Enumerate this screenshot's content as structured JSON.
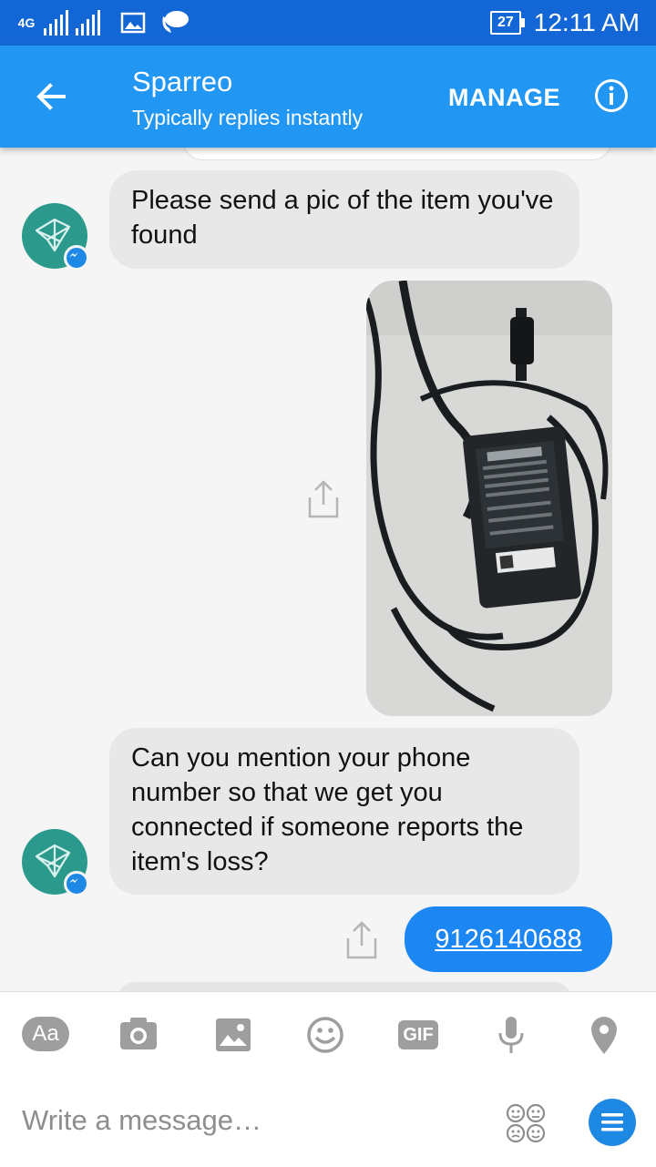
{
  "status_bar": {
    "network": "4G",
    "battery_level": "27",
    "time": "12:11 AM",
    "icons": [
      "signal-icon",
      "signal-icon",
      "image-notification-icon",
      "chat-heads-icon"
    ]
  },
  "header": {
    "title": "Sparreo",
    "subtitle": "Typically replies instantly",
    "manage_label": "MANAGE",
    "back_icon": "arrow-left-icon",
    "info_icon": "info-icon"
  },
  "messages": [
    {
      "sender": "Sparreo",
      "type": "text",
      "text": "Please send a pic of the item you've found"
    },
    {
      "sender": "me",
      "type": "image",
      "subject": "black DELL laptop power adapter with cables"
    },
    {
      "sender": "Sparreo",
      "type": "text",
      "text": "Can you mention your phone number so that we get you connected if someone reports the item's loss?"
    },
    {
      "sender": "me",
      "type": "text",
      "text": "9126140688"
    }
  ],
  "composer": {
    "tools": [
      "text-aa-icon",
      "camera-icon",
      "gallery-icon",
      "emoji-icon",
      "gif-icon",
      "microphone-icon",
      "location-icon"
    ],
    "gif_label": "GIF",
    "aa_label": "Aa",
    "placeholder": "Write a message…"
  },
  "colors": {
    "status_bar": "#1366d6",
    "header": "#2196f3",
    "outgoing_bubble": "#1c87f2",
    "incoming_bubble": "#e8e8e8",
    "avatar": "#2b9a8c"
  }
}
